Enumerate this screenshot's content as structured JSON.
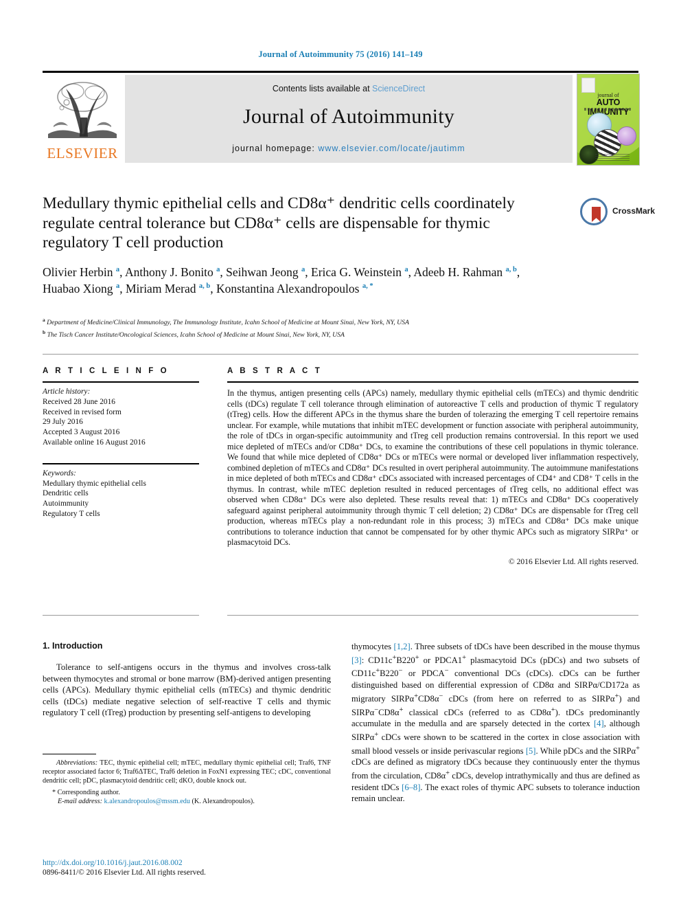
{
  "running_head": "Journal of Autoimmunity 75 (2016) 141–149",
  "masthead": {
    "publisher_name": "ELSEVIER",
    "contents_prefix": "Contents lists available at ",
    "contents_link": "ScienceDirect",
    "journal_title": "Journal of Autoimmunity",
    "homepage_prefix": "journal homepage: ",
    "homepage_url": "www.elsevier.com/locate/jautimm",
    "cover": {
      "line1": "journal of",
      "line2": "AUTO IMMUNITY"
    }
  },
  "crossmark": {
    "label": "CrossMark"
  },
  "article": {
    "title": "Medullary thymic epithelial cells and CD8α⁺ dendritic cells coordinately regulate central tolerance but CD8α⁺ cells are dispensable for thymic regulatory T cell production",
    "authors_html": "Olivier Herbin <sup>a</sup>, Anthony J. Bonito <sup>a</sup>, Seihwan Jeong <sup>a</sup>, Erica G. Weinstein <sup>a</sup>, Adeeb H. Rahman <sup>a, b</sup>, Huabao Xiong <sup>a</sup>, Miriam Merad <sup>a, b</sup>, Konstantina Alexandropoulos <sup>a, *</sup>",
    "affiliations": [
      "Department of Medicine/Clinical Immunology, The Immunology Institute, Icahn School of Medicine at Mount Sinai, New York, NY, USA",
      "The Tisch Cancer Institute/Oncological Sciences, Icahn School of Medicine at Mount Sinai, New York, NY, USA"
    ],
    "affiliation_markers": [
      "a",
      "b"
    ]
  },
  "article_info": {
    "heading": "A R T I C L E   I N F O",
    "history_label": "Article history:",
    "history": [
      "Received 28 June 2016",
      "Received in revised form",
      "29 July 2016",
      "Accepted 3 August 2016",
      "Available online 16 August 2016"
    ],
    "keywords_label": "Keywords:",
    "keywords": [
      "Medullary thymic epithelial cells",
      "Dendritic cells",
      "Autoimmunity",
      "Regulatory T cells"
    ]
  },
  "abstract": {
    "heading": "A B S T R A C T",
    "text": "In the thymus, antigen presenting cells (APCs) namely, medullary thymic epithelial cells (mTECs) and thymic dendritic cells (tDCs) regulate T cell tolerance through elimination of autoreactive T cells and production of thymic T regulatory (tTreg) cells. How the different APCs in the thymus share the burden of tolerazing the emerging T cell repertoire remains unclear. For example, while mutations that inhibit mTEC development or function associate with peripheral autoimmunity, the role of tDCs in organ-specific autoimmunity and tTreg cell production remains controversial. In this report we used mice depleted of mTECs and/or CD8α⁺ DCs, to examine the contributions of these cell populations in thymic tolerance. We found that while mice depleted of CD8α⁺ DCs or mTECs were normal or developed liver inflammation respectively, combined depletion of mTECs and CD8α⁺ DCs resulted in overt peripheral autoimmunity. The autoimmune manifestations in mice depleted of both mTECs and CD8α⁺ cDCs associated with increased percentages of CD4⁺ and CD8⁺ T cells in the thymus. In contrast, while mTEC depletion resulted in reduced percentages of tTreg cells, no additional effect was observed when CD8α⁺ DCs were also depleted. These results reveal that: 1) mTECs and CD8α⁺ DCs cooperatively safeguard against peripheral autoimmunity through thymic T cell deletion; 2) CD8α⁺ DCs are dispensable for tTreg cell production, whereas mTECs play a non-redundant role in this process; 3) mTECs and CD8α⁺ DCs make unique contributions to tolerance induction that cannot be compensated for by other thymic APCs such as migratory SIRPα⁺ or plasmacytoid DCs.",
    "copyright": "© 2016 Elsevier Ltd. All rights reserved."
  },
  "introduction": {
    "heading": "1.  Introduction",
    "left_paragraph": "Tolerance to self-antigens occurs in the thymus and involves cross-talk between thymocytes and stromal or bone marrow (BM)-derived antigen presenting cells (APCs). Medullary thymic epithelial cells (mTECs) and thymic dendritic cells (tDCs) mediate negative selection of self-reactive T cells and thymic regulatory T cell (tTreg) production by presenting self-antigens to developing",
    "right_paragraph_html": "thymocytes <span class=\"ref\">[1,2]</span>. Three subsets of tDCs have been described in the mouse thymus <span class=\"ref\">[3]</span>: CD11c<sup>+</sup>B220<sup>+</sup> or PDCA1<sup>+</sup> plasmacytoid DCs (pDCs) and two subsets of CD11c<sup>+</sup>B220<sup>−</sup> or PDCA<sup>−</sup> conventional DCs (cDCs). cDCs can be further distinguished based on differential expression of CD8α and SIRPα/CD172a as migratory SIRPα<sup>+</sup>CD8α<sup>−</sup> cDCs (from here on referred to as SIRPα<sup>+</sup>) and SIRPα<sup>−</sup>CD8α<sup>+</sup> classical cDCs (referred to as CD8α<sup>+</sup>). tDCs predominantly accumulate in the medulla and are sparsely detected in the cortex <span class=\"ref\">[4]</span>, although SIRPα<sup>+</sup> cDCs were shown to be scattered in the cortex in close association with small blood vessels or inside perivascular regions <span class=\"ref\">[5]</span>. While pDCs and the SIRPα<sup>+</sup> cDCs are defined as migratory tDCs because they continuously enter the thymus from the circulation, CD8α<sup>+</sup> cDCs, develop intrathymically and thus are defined as resident tDCs <span class=\"ref\">[6–8]</span>. The exact roles of thymic APC subsets to tolerance induction remain unclear."
  },
  "footnotes": {
    "abbreviations_label": "Abbreviations:",
    "abbreviations_text": " TEC, thymic epithelial cell; mTEC, medullary thymic epithelial cell; Traf6, TNF receptor associated factor 6; Traf6ΔTEC, Traf6 deletion in FoxN1 expressing TEC; cDC, conventional dendritic cell; pDC, plasmacytoid dendritic cell; dKO, double knock out.",
    "corresponding_marker": "*",
    "corresponding_text": "Corresponding author.",
    "email_label": "E-mail address:",
    "email": "k.alexandropoulos@mssm.edu",
    "email_suffix": "(K. Alexandropoulos)."
  },
  "footer": {
    "doi": "http://dx.doi.org/10.1016/j.jaut.2016.08.002",
    "issn_line": "0896-8411/© 2016 Elsevier Ltd. All rights reserved."
  },
  "colors": {
    "link_blue": "#1a7fb5",
    "sciencedirect_blue": "#5f9fd0",
    "elsevier_orange": "#E87722",
    "banner_gray": "#e3e3e3",
    "crossmark_red": "#c1372a",
    "crossmark_ring": "#4a78a8"
  }
}
